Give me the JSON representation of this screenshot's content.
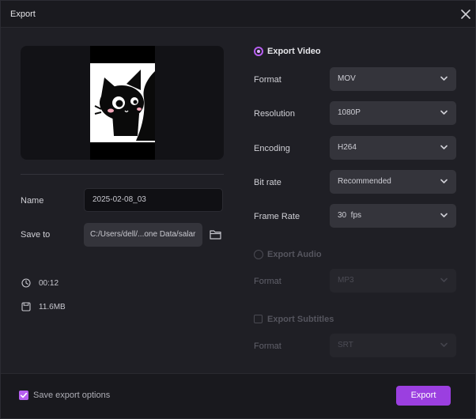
{
  "window": {
    "title": "Export"
  },
  "left": {
    "name_label": "Name",
    "name_value": "2025-02-08_03",
    "save_label": "Save to",
    "save_path": "C:/Users/dell/...one Data/salar",
    "duration": "00:12",
    "size": "11.6MB"
  },
  "video": {
    "title": "Export Video",
    "format_label": "Format",
    "format_value": "MOV",
    "resolution_label": "Resolution",
    "resolution_value": "1080P",
    "encoding_label": "Encoding",
    "encoding_value": "H264",
    "bitrate_label": "Bit rate",
    "bitrate_value": "Recommended",
    "framerate_label": "Frame Rate",
    "framerate_value": "30  fps"
  },
  "audio": {
    "title": "Export Audio",
    "format_label": "Format",
    "format_value": "MP3"
  },
  "subtitles": {
    "title": "Export Subtitles",
    "format_label": "Format",
    "format_value": "SRT"
  },
  "footer": {
    "save_options_label": "Save export options",
    "export_label": "Export"
  },
  "colors": {
    "accent": "#9b3fe0",
    "radio_accent": "#b75ff0",
    "background": "#1f1f25",
    "field": "#34343b"
  },
  "icons": {
    "close": "close-icon",
    "folder": "folder-icon",
    "duration": "clock-icon",
    "size": "save-disk-icon",
    "dropdown": "chevron-down-icon"
  }
}
